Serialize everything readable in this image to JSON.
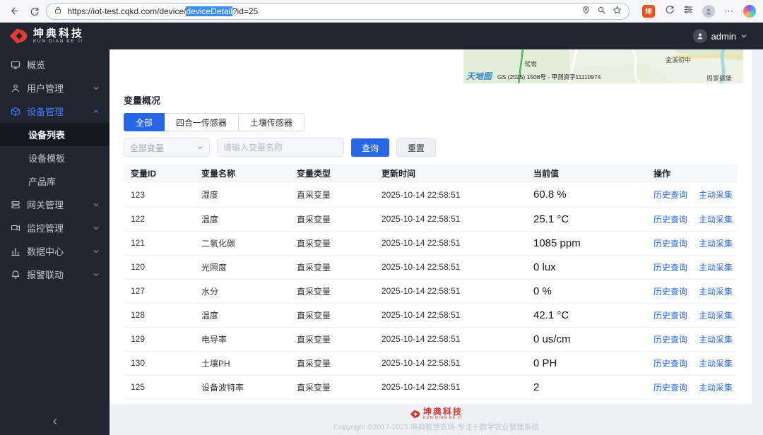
{
  "browser": {
    "url_prefix": "https://iot-test.cqkd.com/device/",
    "url_selected": "deviceDetail",
    "url_suffix": "?id=25"
  },
  "header": {
    "brand_cn": "坤典科技",
    "brand_en": "KUN DIAN KE JI",
    "user": "admin"
  },
  "sidebar": {
    "items": [
      {
        "key": "overview",
        "label": "概览",
        "icon": "overview-icon",
        "type": "item"
      },
      {
        "key": "user-mgmt",
        "label": "用户管理",
        "icon": "user-icon",
        "type": "group"
      },
      {
        "key": "device-mgmt",
        "label": "设备管理",
        "icon": "device-icon",
        "type": "group",
        "active": true,
        "expanded": true
      },
      {
        "key": "device-list",
        "label": "设备列表",
        "type": "sub",
        "selected": true
      },
      {
        "key": "device-template",
        "label": "设备模板",
        "type": "sub"
      },
      {
        "key": "product-lib",
        "label": "产品库",
        "type": "sub"
      },
      {
        "key": "gateway-mgmt",
        "label": "网关管理",
        "icon": "gateway-icon",
        "type": "group"
      },
      {
        "key": "monitor-mgmt",
        "label": "监控管理",
        "icon": "camera-icon",
        "type": "group"
      },
      {
        "key": "data-center",
        "label": "数据中心",
        "icon": "chart-icon",
        "type": "group"
      },
      {
        "key": "alarm-linkage",
        "label": "报警联动",
        "icon": "alarm-icon",
        "type": "group"
      }
    ]
  },
  "map": {
    "labels": [
      "鸳鸯",
      "金溪初中",
      "周家碉堡"
    ],
    "watermark": "天地图",
    "attribution": "GS (2025) 1508号 - 甲测资字11110974"
  },
  "section": {
    "title": "变量概况",
    "tabs": [
      "全部",
      "四合一传感器",
      "土壤传感器"
    ],
    "active_tab": "全部",
    "filter": {
      "select_value": "全部变量",
      "input_placeholder": "请输入变量名称",
      "query_label": "查询",
      "reset_label": "重置"
    }
  },
  "table": {
    "headers": [
      "变量ID",
      "变量名称",
      "变量类型",
      "更新时间",
      "当前值",
      "操作"
    ],
    "action_labels": [
      "历史查询",
      "主动采集"
    ],
    "rows": [
      {
        "id": "123",
        "name": "湿度",
        "type": "直采变量",
        "time": "2025-10-14 22:58:51",
        "value": "60.8 %"
      },
      {
        "id": "122",
        "name": "温度",
        "type": "直采变量",
        "time": "2025-10-14 22:58:51",
        "value": "25.1 °C"
      },
      {
        "id": "121",
        "name": "二氧化碳",
        "type": "直采变量",
        "time": "2025-10-14 22:58:51",
        "value": "1085 ppm"
      },
      {
        "id": "120",
        "name": "光照度",
        "type": "直采变量",
        "time": "2025-10-14 22:58:51",
        "value": "0 lux"
      },
      {
        "id": "127",
        "name": "水分",
        "type": "直采变量",
        "time": "2025-10-14 22:58:51",
        "value": "0 %"
      },
      {
        "id": "128",
        "name": "温度",
        "type": "直采变量",
        "time": "2025-10-14 22:58:51",
        "value": "42.1 °C"
      },
      {
        "id": "129",
        "name": "电导率",
        "type": "直采变量",
        "time": "2025-10-14 22:58:51",
        "value": "0 us/cm"
      },
      {
        "id": "130",
        "name": "土壤PH",
        "type": "直采变量",
        "time": "2025-10-14 22:58:51",
        "value": "0 PH"
      },
      {
        "id": "125",
        "name": "设备波特率",
        "type": "直采变量",
        "time": "2025-10-14 22:58:51",
        "value": "2"
      }
    ]
  },
  "footer": {
    "brand_cn": "坤典科技",
    "brand_en": "KUN DIAN KE JI",
    "copyright": "Copyright ©2017-2025 坤典智慧农场-专注于数字农业管理系统"
  }
}
